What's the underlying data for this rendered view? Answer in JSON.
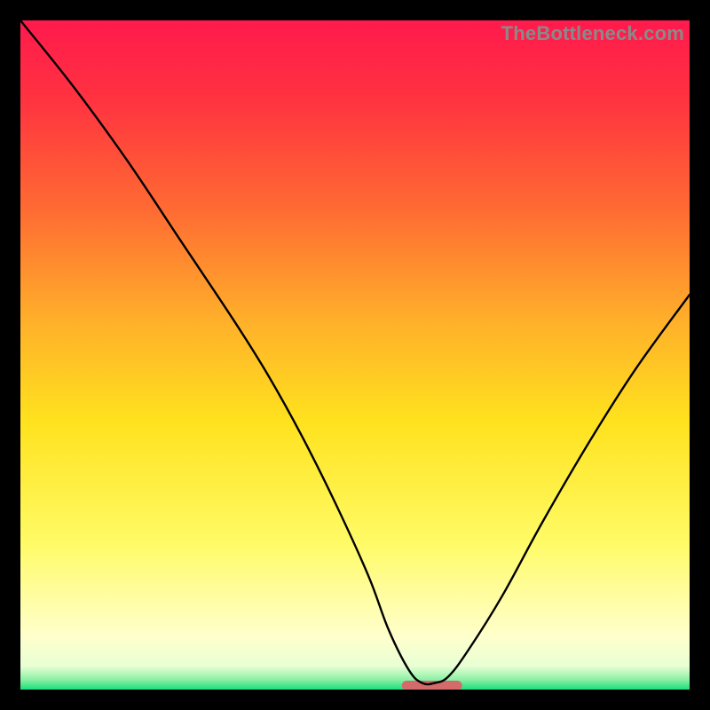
{
  "watermark": "TheBottleneck.com",
  "chart_data": {
    "type": "line",
    "title": "",
    "xlabel": "",
    "ylabel": "",
    "xlim": [
      0,
      100
    ],
    "ylim": [
      0,
      100
    ],
    "grid": false,
    "legend": false,
    "series": [
      {
        "name": "bottleneck-curve",
        "x": [
          0,
          8,
          16,
          24,
          32,
          37,
          42,
          47,
          52,
          55,
          58,
          60,
          62,
          64,
          67,
          72,
          78,
          85,
          92,
          100
        ],
        "values": [
          100,
          90,
          79,
          67,
          55,
          47,
          38,
          28,
          17,
          9,
          3,
          1,
          1,
          2,
          6,
          14,
          25,
          37,
          48,
          59
        ]
      }
    ],
    "annotations": [
      {
        "name": "red-marker",
        "type": "bar",
        "x_start": 57,
        "x_end": 66,
        "y": 0.6,
        "color": "#d46a6a"
      }
    ],
    "background_gradient": {
      "stops": [
        {
          "offset": 0.0,
          "color": "#ff1a4d"
        },
        {
          "offset": 0.12,
          "color": "#ff3340"
        },
        {
          "offset": 0.28,
          "color": "#ff6a33"
        },
        {
          "offset": 0.45,
          "color": "#ffb02a"
        },
        {
          "offset": 0.6,
          "color": "#ffe21e"
        },
        {
          "offset": 0.78,
          "color": "#fffb66"
        },
        {
          "offset": 0.92,
          "color": "#ffffcc"
        },
        {
          "offset": 0.965,
          "color": "#e8ffd4"
        },
        {
          "offset": 0.985,
          "color": "#8cf0a5"
        },
        {
          "offset": 1.0,
          "color": "#18e07a"
        }
      ]
    }
  }
}
